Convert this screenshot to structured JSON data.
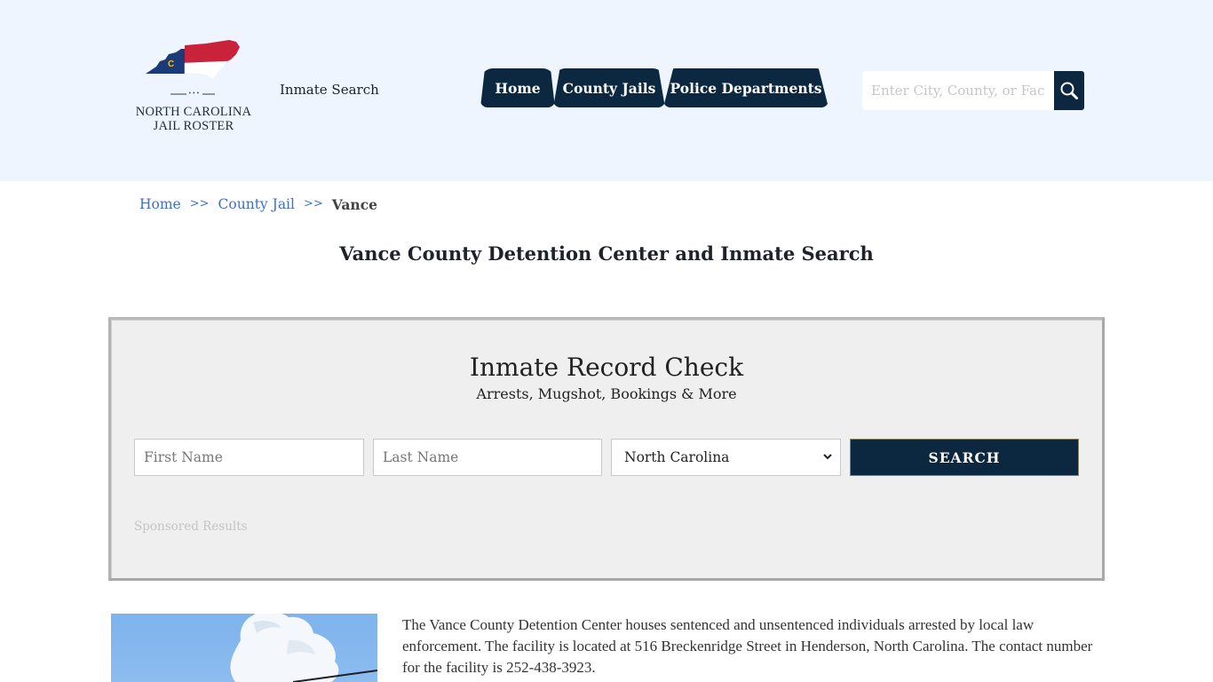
{
  "header": {
    "logo": {
      "line1": "NORTH CAROLINA",
      "line2": "JAIL ROSTER",
      "dots": "•••",
      "flag_colors": {
        "blue": "#1d3a78",
        "red": "#c8233a",
        "white": "#ffffff",
        "gold": "#f3c317"
      }
    },
    "inmate_search_label": "Inmate Search",
    "nav": [
      {
        "label": "Home"
      },
      {
        "label": "County Jails"
      },
      {
        "label": "Police Departments"
      }
    ],
    "search": {
      "placeholder": "Enter City, County, or Facility",
      "icon": "search-icon"
    }
  },
  "breadcrumb": {
    "items": [
      {
        "label": "Home"
      },
      {
        "label": "County Jail"
      }
    ],
    "separator": ">>",
    "current": "Vance"
  },
  "page_title": "Vance County Detention Center and Inmate Search",
  "record_check": {
    "title": "Inmate Record Check",
    "subtitle": "Arrests, Mugshot, Bookings & More",
    "first_name_placeholder": "First Name",
    "last_name_placeholder": "Last Name",
    "state_selected": "North Carolina",
    "search_label": "SEARCH",
    "sponsored_label": "Sponsored Results"
  },
  "facility": {
    "description": "The Vance County Detention Center houses sentenced and unsentenced individuals arrested by local law enforcement. The facility is located at 516 Breckenridge Street in Henderson, North Carolina. The contact number for the facility is 252-438-3923."
  },
  "colors": {
    "header_bg": "#eef5fe",
    "navy": "#0b2840",
    "link": "#3b6fcb",
    "panel_bg": "#efefef"
  }
}
